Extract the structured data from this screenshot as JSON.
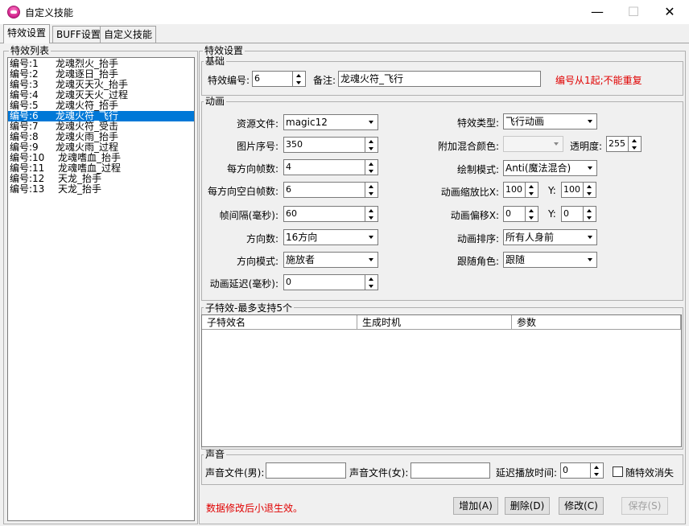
{
  "window": {
    "title": "自定义技能",
    "minimize": "—",
    "maximize": "☐",
    "close": "✕"
  },
  "tabs": [
    {
      "label": "特效设置"
    },
    {
      "label": "BUFF设置"
    },
    {
      "label": "自定义技能"
    }
  ],
  "effect_list": {
    "title": "特效列表",
    "selected_index": 5,
    "items": [
      {
        "num": "编号:1",
        "name": "龙魂烈火_抬手"
      },
      {
        "num": "编号:2",
        "name": "龙魂逐日_抬手"
      },
      {
        "num": "编号:3",
        "name": "龙魂灭天火_抬手"
      },
      {
        "num": "编号:4",
        "name": "龙魂灭天火_过程"
      },
      {
        "num": "编号:5",
        "name": "龙魂火符_抬手"
      },
      {
        "num": "编号:6",
        "name": "龙魂火符_飞行"
      },
      {
        "num": "编号:7",
        "name": "龙魂火符_受击"
      },
      {
        "num": "编号:8",
        "name": "龙魂火雨_抬手"
      },
      {
        "num": "编号:9",
        "name": "龙魂火雨_过程"
      },
      {
        "num": "编号:10",
        "name": "龙魂嗜血_抬手"
      },
      {
        "num": "编号:11",
        "name": "龙魂嗜血_过程"
      },
      {
        "num": "编号:12",
        "name": "天龙_抬手"
      },
      {
        "num": "编号:13",
        "name": "天龙_抬手"
      }
    ]
  },
  "settings": {
    "title": "特效设置",
    "basic": {
      "title": "基础",
      "id_label": "特效编号:",
      "id_value": "6",
      "note_label": "备注:",
      "note_value": "龙魂火符_飞行",
      "hint": "编号从1起;不能重复"
    },
    "animation": {
      "title": "动画",
      "resource_file_label": "资源文件:",
      "resource_file_value": "magic12",
      "image_index_label": "图片序号:",
      "image_index_value": "350",
      "frames_per_dir_label": "每方向帧数:",
      "frames_per_dir_value": "4",
      "blank_frames_label": "每方向空白帧数:",
      "blank_frames_value": "6",
      "frame_interval_label": "帧间隔(毫秒):",
      "frame_interval_value": "60",
      "direction_count_label": "方向数:",
      "direction_count_value": "16方向",
      "direction_mode_label": "方向模式:",
      "direction_mode_value": "施放者",
      "delay_label": "动画延迟(毫秒):",
      "delay_value": "0",
      "effect_type_label": "特效类型:",
      "effect_type_value": "飞行动画",
      "blend_color_label": "附加混合颜色:",
      "blend_color_value": "",
      "opacity_label": "透明度:",
      "opacity_value": "255",
      "draw_mode_label": "绘制模式:",
      "draw_mode_value": "Anti(魔法混合)",
      "scale_label": "动画缩放比X:",
      "scale_x": "100",
      "scale_y_label": "Y:",
      "scale_y": "100",
      "offset_label": "动画偏移X:",
      "offset_x": "0",
      "offset_y_label": "Y:",
      "offset_y": "0",
      "order_label": "动画排序:",
      "order_value": "所有人身前",
      "follow_label": "跟随角色:",
      "follow_value": "跟随"
    },
    "sub_effects": {
      "title": "子特效-最多支持5个",
      "columns": [
        "子特效名",
        "生成时机",
        "参数"
      ]
    },
    "sound": {
      "title": "声音",
      "male_label": "声音文件(男):",
      "male_value": "",
      "female_label": "声音文件(女):",
      "female_value": "",
      "delay_label": "延迟播放时间:",
      "delay_value": "0",
      "vanish_label": "随特效消失"
    },
    "footer": {
      "notice": "数据修改后小退生效。",
      "add": "增加(A)",
      "delete": "删除(D)",
      "modify": "修改(C)",
      "save": "保存(S)"
    }
  },
  "colors": {
    "selection": "#0078d7",
    "warning_text": "#e00000"
  }
}
